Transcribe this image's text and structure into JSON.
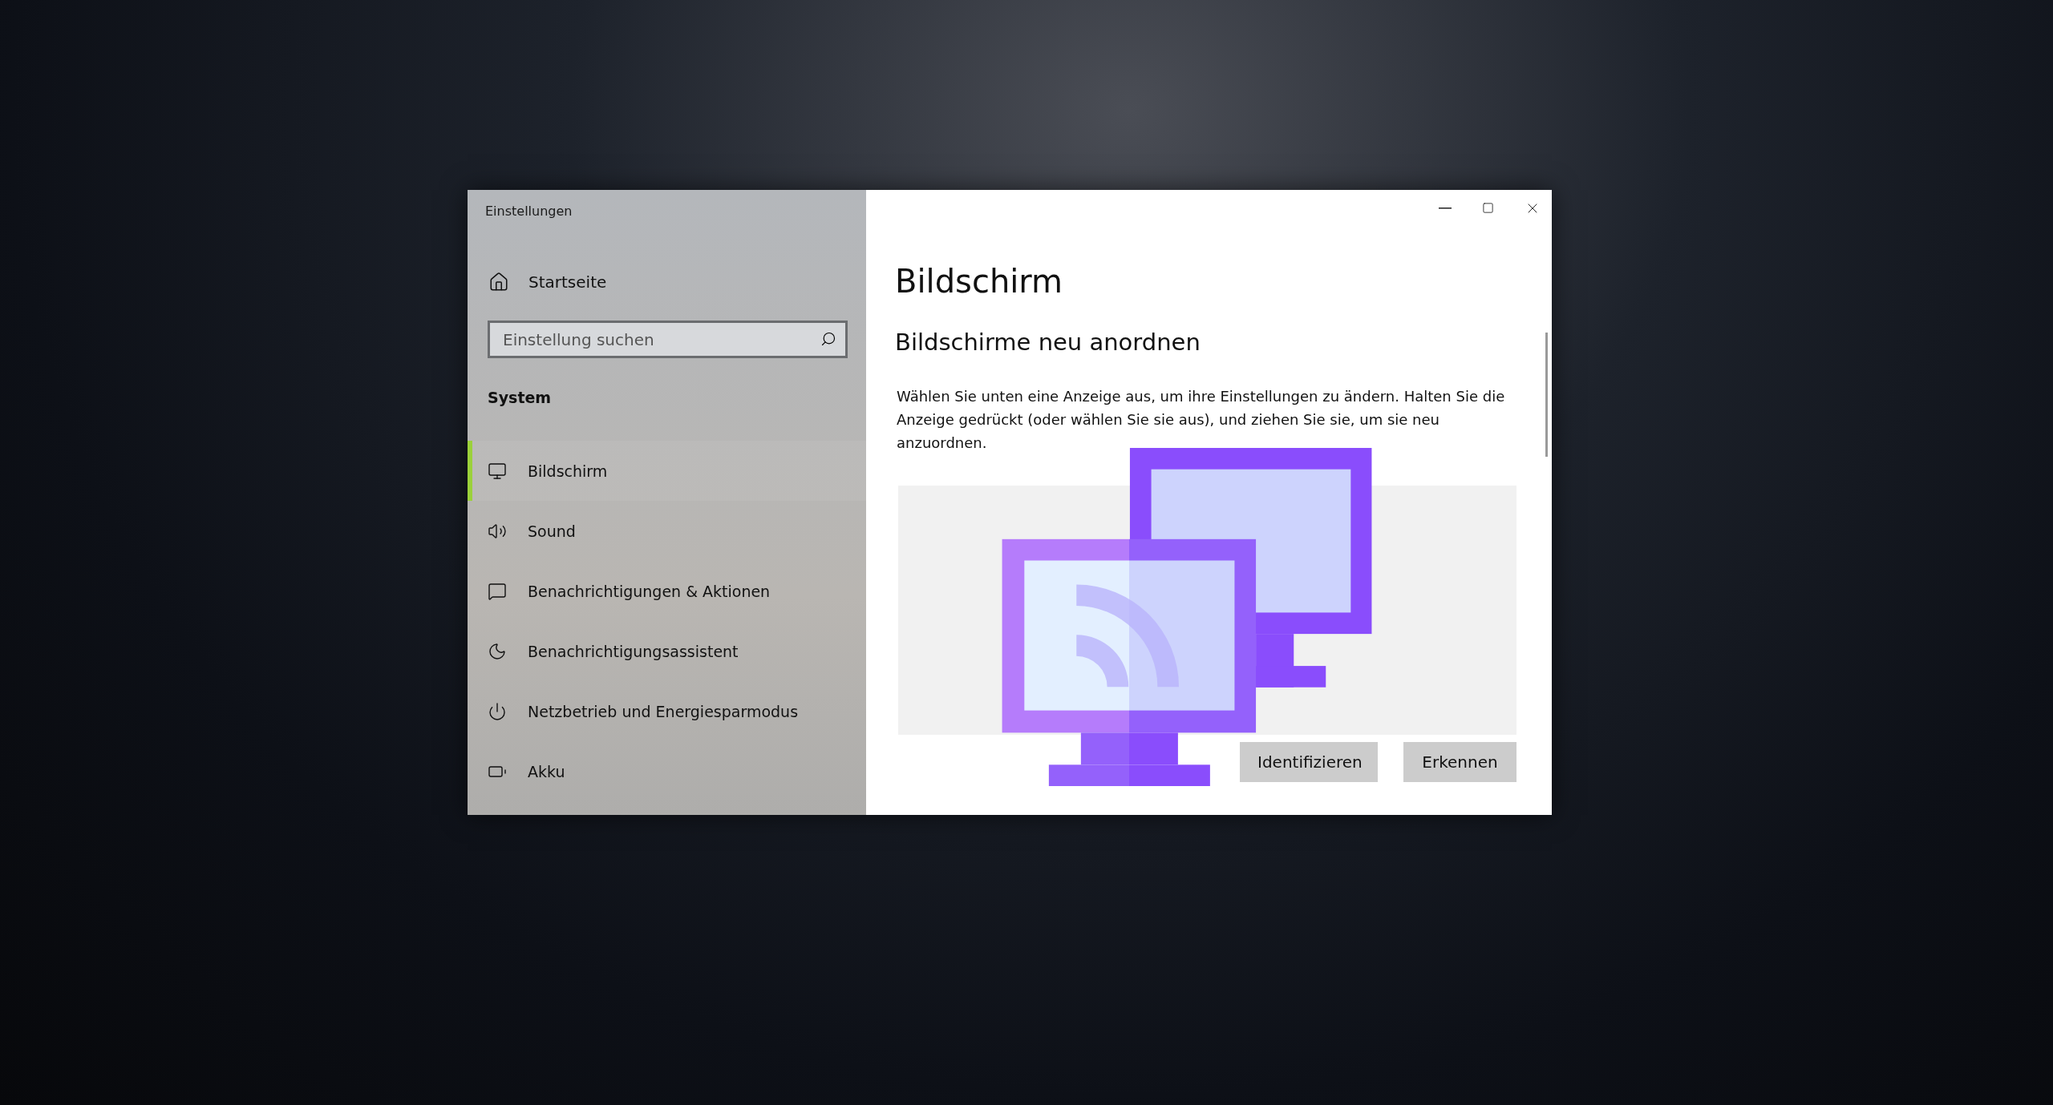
{
  "window": {
    "title": "Einstellungen"
  },
  "sidebar": {
    "home": {
      "label": "Startseite"
    },
    "search": {
      "placeholder": "Einstellung suchen"
    },
    "section": "System",
    "items": [
      {
        "label": "Bildschirm",
        "selected": true
      },
      {
        "label": "Sound",
        "selected": false
      },
      {
        "label": "Benachrichtigungen & Aktionen",
        "selected": false
      },
      {
        "label": "Benachrichtigungsassistent",
        "selected": false
      },
      {
        "label": "Netzbetrieb und Energiesparmodus",
        "selected": false
      },
      {
        "label": "Akku",
        "selected": false
      }
    ]
  },
  "content": {
    "title": "Bildschirm",
    "heading": "Bildschirme neu anordnen",
    "description": "Wählen Sie unten eine Anzeige aus, um ihre Einstellungen zu ändern. Halten Sie die Anzeige gedrückt (oder wählen Sie sie aus), und ziehen Sie sie, um sie neu anzuordnen.",
    "buttons": [
      "Identifizieren",
      "Erkennen"
    ]
  }
}
